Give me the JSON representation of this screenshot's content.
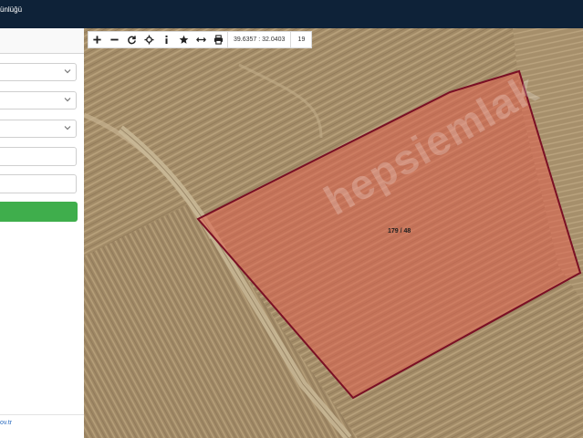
{
  "header": {
    "title": "ünlüğü"
  },
  "panel": {
    "fields": [
      {
        "value": ""
      },
      {
        "value": ""
      },
      {
        "value": ""
      },
      {
        "value": ""
      },
      {
        "value": ""
      }
    ],
    "footer_link": "ov.tr"
  },
  "map": {
    "coordinates": "39.6357 : 32.0403",
    "zoom_level": "19",
    "parcel_label": "179 / 48",
    "watermark": "hepsiemlak",
    "parcel_color": "#e0614f",
    "parcel_border": "#7a0f24"
  },
  "toolbar": {
    "tools": [
      "plus-icon",
      "minus-icon",
      "refresh-icon",
      "locate-icon",
      "info-icon",
      "star-icon",
      "measure-icon",
      "print-icon"
    ]
  },
  "colors": {
    "header_bg": "#0e2238",
    "query_button": "#3fae4c"
  }
}
